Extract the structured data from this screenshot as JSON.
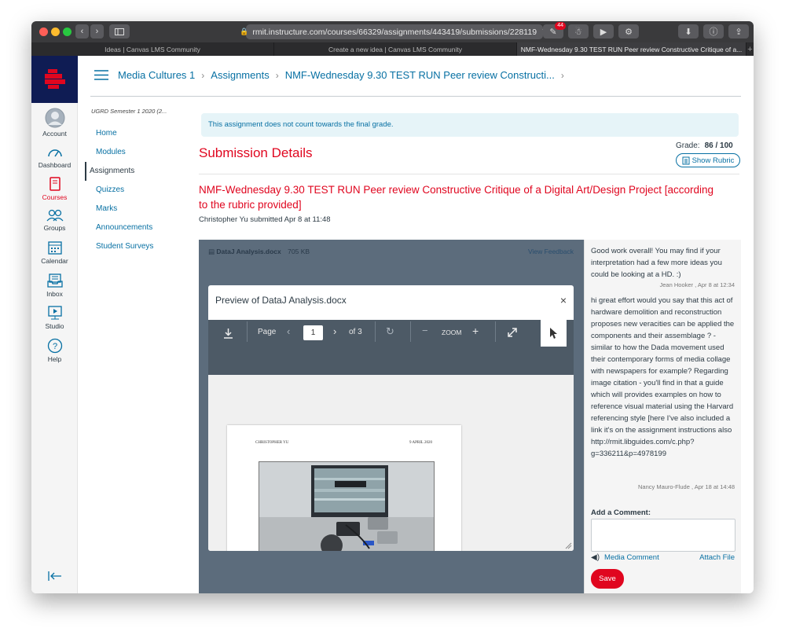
{
  "browser": {
    "url": "rmit.instructure.com/courses/66329/assignments/443419/submissions/228119",
    "badge_count": "44",
    "tabs": [
      {
        "label": "Ideas | Canvas LMS Community"
      },
      {
        "label": "Create a new idea | Canvas LMS Community"
      },
      {
        "label": "NMF-Wednesday 9.30 TEST RUN Peer review Constructive Critique of a..."
      }
    ]
  },
  "global_nav": {
    "items": [
      {
        "label": "Account",
        "icon": "avatar-icon"
      },
      {
        "label": "Dashboard",
        "icon": "dashboard-icon"
      },
      {
        "label": "Courses",
        "icon": "book-icon"
      },
      {
        "label": "Groups",
        "icon": "groups-icon"
      },
      {
        "label": "Calendar",
        "icon": "calendar-icon"
      },
      {
        "label": "Inbox",
        "icon": "inbox-icon"
      },
      {
        "label": "Studio",
        "icon": "studio-icon"
      },
      {
        "label": "Help",
        "icon": "help-icon"
      }
    ]
  },
  "breadcrumb": {
    "course": "Media Cultures 1",
    "section": "Assignments",
    "page": "NMF-Wednesday 9.30 TEST RUN Peer review Constructi..."
  },
  "course_nav": {
    "term": "UGRD Semester 1 2020 (2...",
    "items": [
      "Home",
      "Modules",
      "Assignments",
      "Quizzes",
      "Marks",
      "Announcements",
      "Student Surveys"
    ]
  },
  "notice": "This assignment does not count towards the final grade.",
  "submission": {
    "heading": "Submission Details",
    "grade_label": "Grade:",
    "grade_value": "86 / 100",
    "rubric_label": "Show Rubric",
    "assignment_title": "NMF-Wednesday 9.30 TEST RUN Peer review Constructive Critique of a Digital Art/Design Project [according to the rubric provided]",
    "submitted_text": "Christopher Yu submitted Apr 8 at 11:48"
  },
  "viewer": {
    "file_name": "DataJ Analysis.docx",
    "file_size": "705 KB",
    "view_feedback": "View Feedback",
    "preview_title": "Preview of DataJ Analysis.docx",
    "page_label": "Page",
    "page_value": "1",
    "of_pages": "of 3",
    "zoom_label": "ZOOM",
    "doc_author": "CHRISTOPHER YU",
    "doc_date": "9 APRIL 2020"
  },
  "comments": [
    {
      "text": "Good work overall! You may find if your interpretation had a few more ideas you could be looking at a HD. :)",
      "author": "Jean Hooker , Apr 8 at 12:34"
    },
    {
      "text": "hi great effort would you say that this act of hardware demolition and reconstruction proposes new veracities can be applied the components and their assemblage ? - similar to how the Dada movement used their contemporary forms of media collage with newspapers for example? Regarding image citation -  you'll find in that a guide which will provides examples on how to reference visual material using the Harvard referencing style [here I've also included a link it's on the assignment instructions also http://rmit.libguides.com/c.php?g=336211&p=4978199",
      "author": "Nancy Mauro-Flude , Apr 18 at 14:48"
    }
  ],
  "comment_form": {
    "label": "Add a Comment:",
    "media_comment": "Media Comment",
    "attach_file": "Attach File",
    "save": "Save"
  },
  "colors": {
    "brand_red": "#e0061f",
    "link_blue": "#0770a3",
    "nav_logo_bg": "#0f1c54"
  }
}
